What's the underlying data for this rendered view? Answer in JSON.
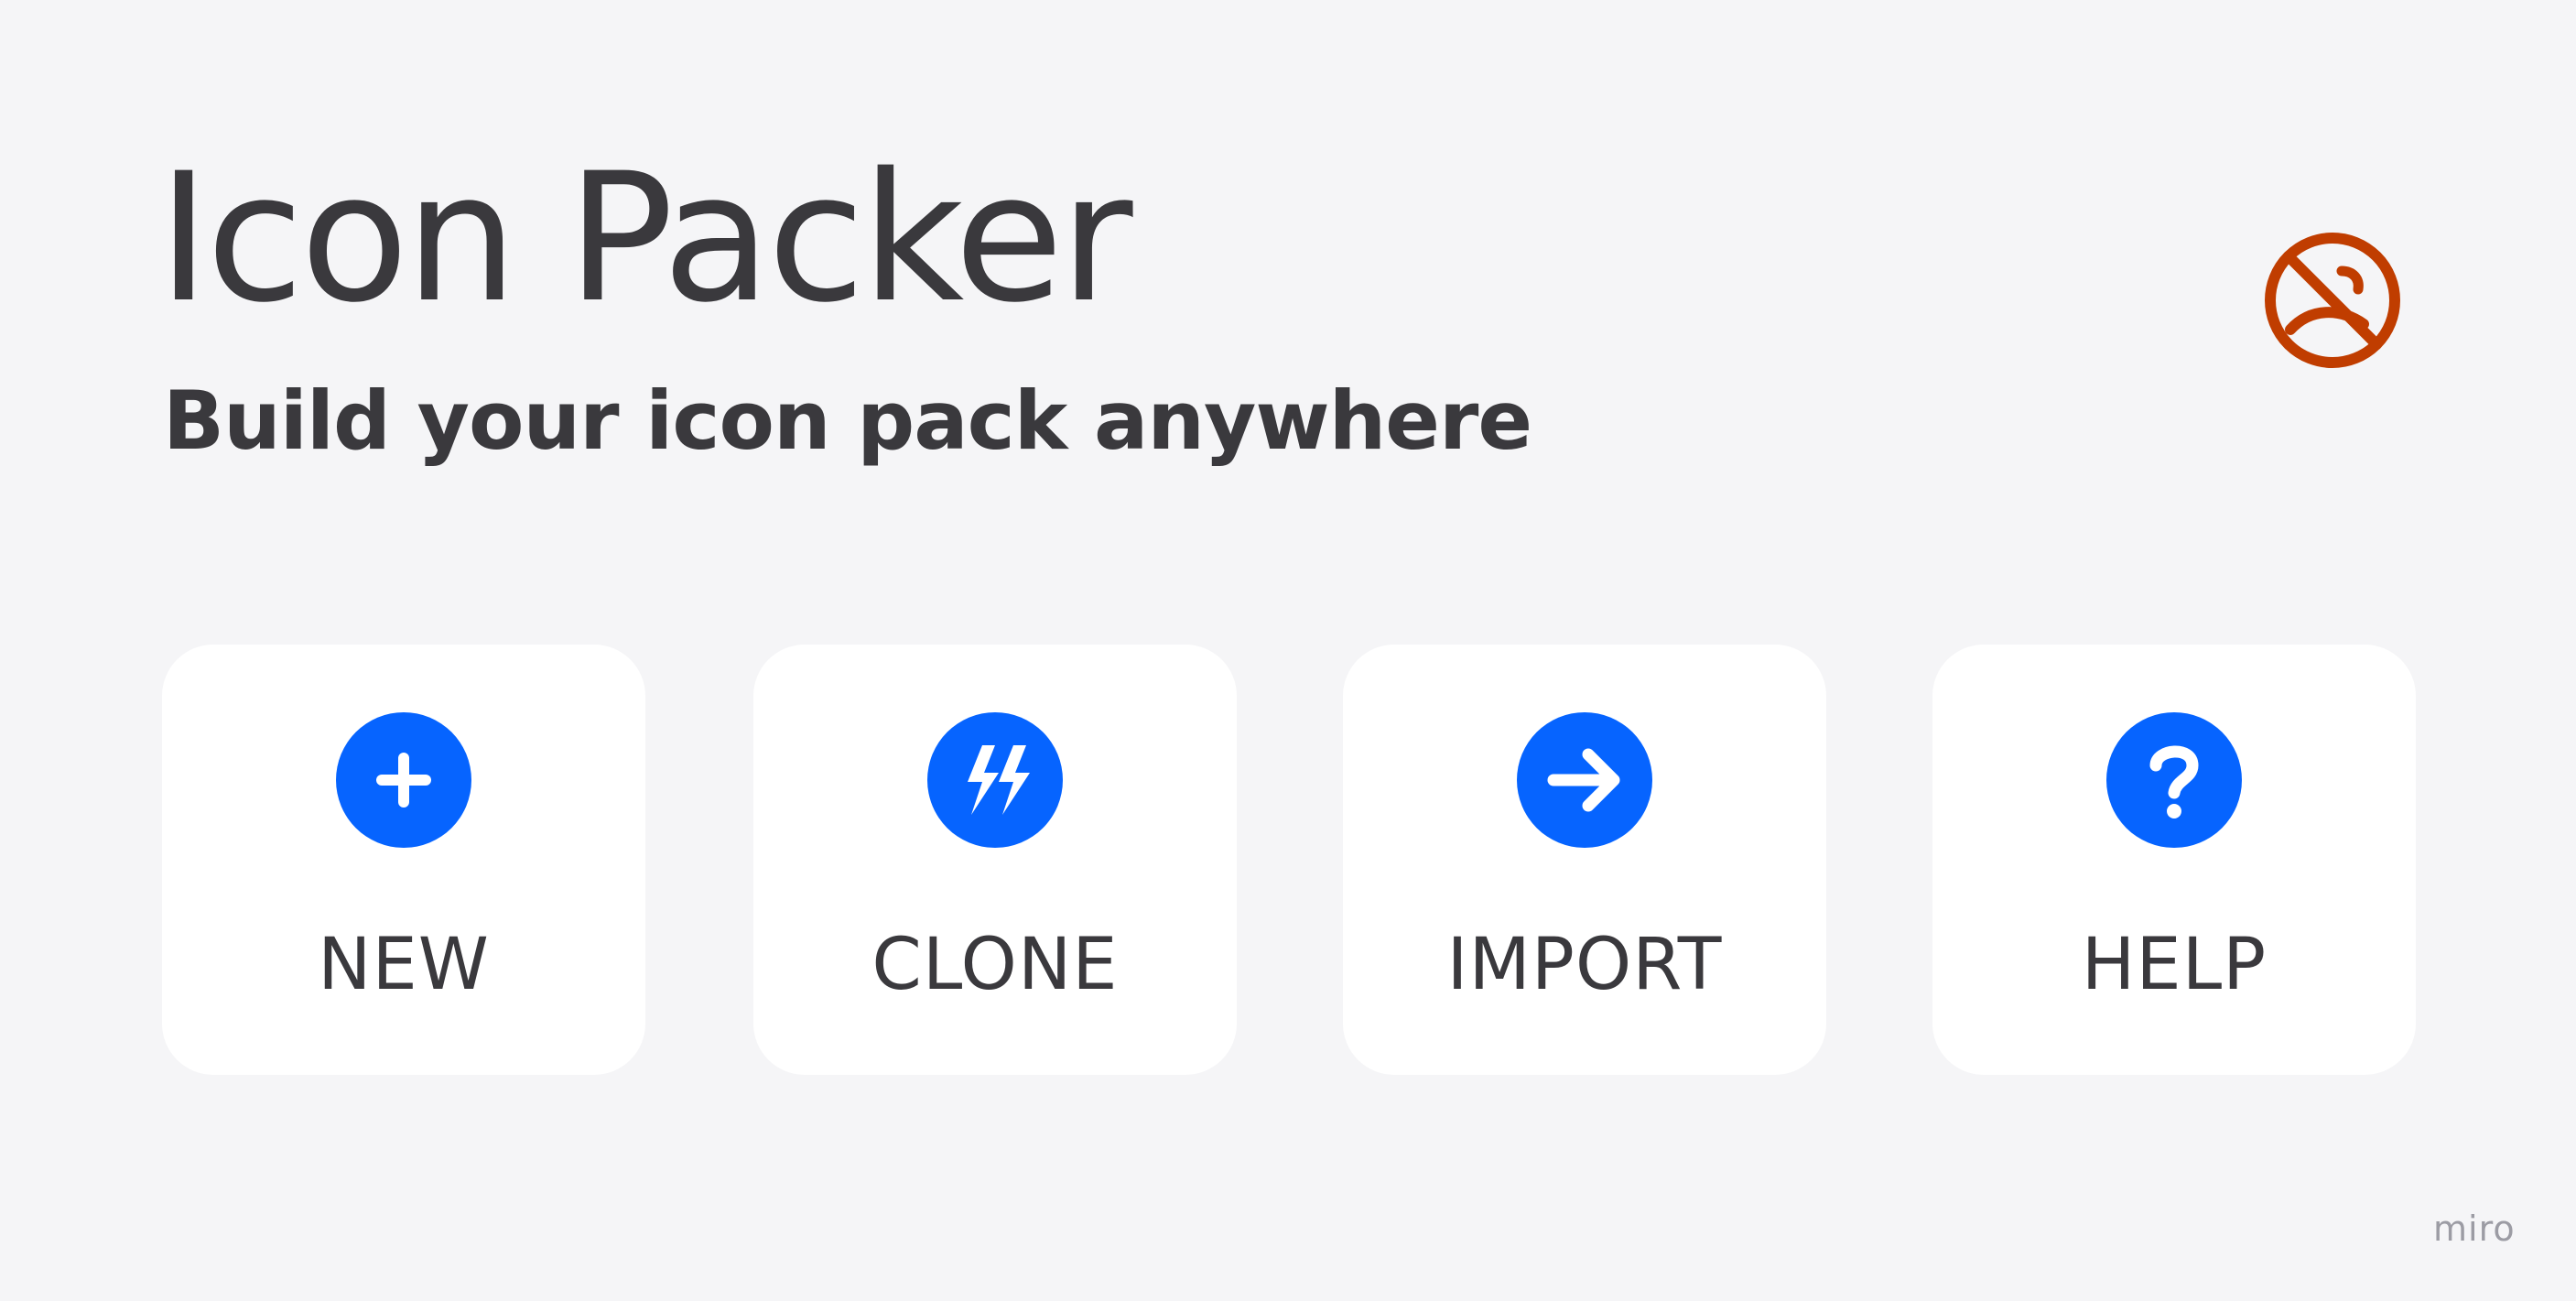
{
  "header": {
    "title": "Icon Packer",
    "subtitle": "Build your icon pack anywhere"
  },
  "status": {
    "icon": "no-smoking-icon",
    "color": "#c03d00"
  },
  "actions": [
    {
      "label": "NEW",
      "icon": "plus-icon"
    },
    {
      "label": "CLONE",
      "icon": "lightning-icon"
    },
    {
      "label": "IMPORT",
      "icon": "arrow-right-icon"
    },
    {
      "label": "HELP",
      "icon": "question-icon"
    }
  ],
  "theme": {
    "accent": "#0664ff",
    "background": "#f5f5f7",
    "card": "#ffffff",
    "text": "#3a393d"
  },
  "watermark": "miro"
}
